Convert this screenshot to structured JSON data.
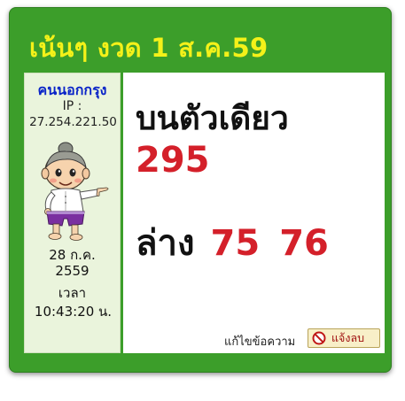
{
  "post": {
    "title": "เน้นๆ งวด 1 ส.ค.59",
    "poster": {
      "name": "คนนอกกรุง",
      "ip_label": "IP :",
      "ip": "27.254.221.50",
      "date": "28 ก.ค.",
      "year": "2559",
      "time_label": "เวลา",
      "time": "10:43:20 น.",
      "avatar_icon": "cartoon-boy-avatar-icon"
    },
    "content": {
      "heading": "บนตัวเดียว",
      "number": "295",
      "bottom_label": "ล่าง",
      "bottom_numbers": [
        "75",
        "76"
      ]
    },
    "actions": {
      "edit_label": "แก้ไขข้อความ",
      "report_label": "แจ้งลบ",
      "report_icon": "ban-icon"
    }
  },
  "colors": {
    "frame_green": "#3c9e2a",
    "title_yellow": "#f4f119",
    "poster_panel_bg": "#eaf4dc",
    "poster_name_blue": "#0a24c8",
    "number_red": "#d4202a"
  }
}
